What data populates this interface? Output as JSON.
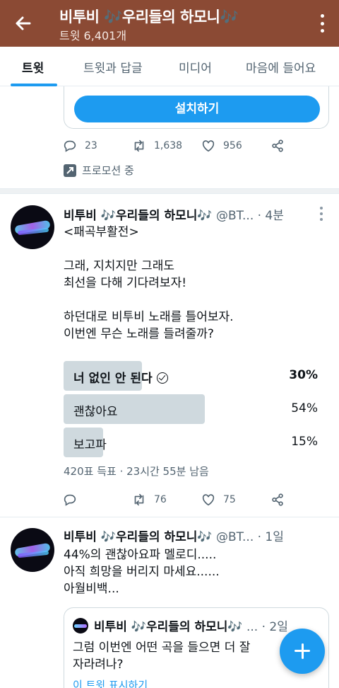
{
  "header": {
    "title": "비투비 🎶우리들의 하모니🎶",
    "subtitle": "트윗 6,401개"
  },
  "tabs": [
    {
      "label": "트윗",
      "active": true
    },
    {
      "label": "트윗과 답글",
      "active": false
    },
    {
      "label": "미디어",
      "active": false
    },
    {
      "label": "마음에 들어요",
      "active": false
    }
  ],
  "promo_tweet": {
    "install_label": "설치하기",
    "replies": "23",
    "retweets": "1,638",
    "likes": "956",
    "promoted_label": "프로모션 중"
  },
  "tweet1": {
    "name": "비투비 🎶우리들의 하모니🎶",
    "handle_time": " @BT... · 4분",
    "text": "<패곡부활전>\n\n그래, 지치지만 그래도\n최선을 다해 기다려보자!\n\n하던대로 비투비 노래를 틀어보자.\n이번엔 무슨 노래를 들려줄까?",
    "poll": [
      {
        "label": "너 없인 안 된다",
        "percent": "30%",
        "value": 30,
        "selected": true
      },
      {
        "label": "괜찮아요",
        "percent": "54%",
        "value": 54,
        "selected": false
      },
      {
        "label": "보고파",
        "percent": "15%",
        "value": 15,
        "selected": false
      }
    ],
    "poll_meta": "420표 득표 · 23시간 55분 남음",
    "retweets": "76",
    "likes": "75"
  },
  "tweet2": {
    "name": "비투비 🎶우리들의 하모니🎶",
    "handle_time": " @BT... · 1일",
    "text": "44%의 괜찮아요파 멜로디.....\n아직 희망을 버리지 마세요......\n아월비백...",
    "quote": {
      "name": "비투비 🎶우리들의 하모니🎶",
      "time": " ... · 2일",
      "text": "그럼 이번엔 어떤 곡을 들으면 더 잘\n자라려나?",
      "link": "이 트윗 표시하기"
    }
  },
  "colors": {
    "header_bg": "#8b4a34",
    "accent": "#1d9bf0",
    "poll_bar": "#cfd9de"
  },
  "icons": [
    "back-arrow-icon",
    "more-vertical-icon",
    "reply-icon",
    "retweet-icon",
    "like-icon",
    "share-icon",
    "promoted-icon",
    "check-circle-icon",
    "compose-plus-icon"
  ]
}
